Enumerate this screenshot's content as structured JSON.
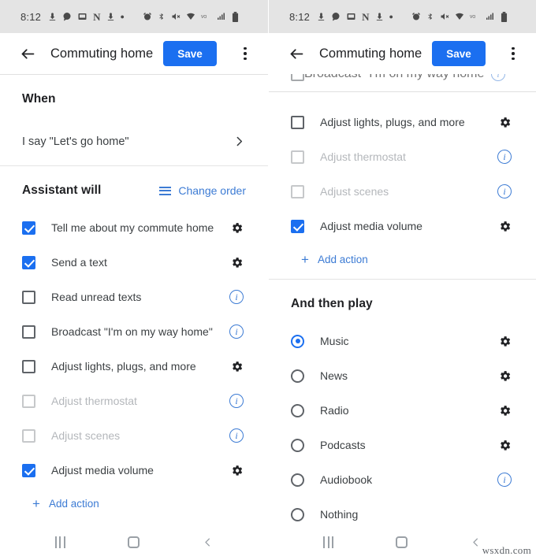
{
  "status_bar": {
    "time": "8:12",
    "icons": [
      "download-icon",
      "chat-bubble-icon",
      "screenshot-icon",
      "netflix-n-icon",
      "download-icon",
      "dot-icon",
      "alarm-icon",
      "bluetooth-icon",
      "mute-icon",
      "wifi-icon",
      "vo-lte-icon",
      "signal-icon",
      "battery-icon"
    ]
  },
  "app_bar": {
    "back_label": "back-arrow",
    "title": "Commuting home",
    "save_label": "Save",
    "overflow_label": "more-options"
  },
  "left_panel": {
    "when": {
      "heading": "When",
      "trigger_text": "I say \"Let's go home\"",
      "chevron": "chevron-right-icon"
    },
    "assistant": {
      "heading": "Assistant will",
      "change_order_label": "Change order",
      "actions": [
        {
          "label": "Tell me about my commute home",
          "checked": true,
          "disabled": false,
          "trailing": "gear"
        },
        {
          "label": "Send a text",
          "checked": true,
          "disabled": false,
          "trailing": "gear"
        },
        {
          "label": "Read unread texts",
          "checked": false,
          "disabled": false,
          "trailing": "info"
        },
        {
          "label": "Broadcast \"I'm on my way home\"",
          "checked": false,
          "disabled": false,
          "trailing": "info"
        },
        {
          "label": "Adjust lights, plugs, and more",
          "checked": false,
          "disabled": false,
          "trailing": "gear"
        },
        {
          "label": "Adjust thermostat",
          "checked": false,
          "disabled": true,
          "trailing": "info"
        },
        {
          "label": "Adjust scenes",
          "checked": false,
          "disabled": true,
          "trailing": "info"
        },
        {
          "label": "Adjust media volume",
          "checked": true,
          "disabled": false,
          "trailing": "gear"
        }
      ],
      "add_action_label": "Add action"
    }
  },
  "right_panel": {
    "clipped_action": {
      "label": "Broadcast \"I'm on my way home\"",
      "checked": false,
      "trailing": "info"
    },
    "assistant": {
      "actions": [
        {
          "label": "Adjust lights, plugs, and more",
          "checked": false,
          "disabled": false,
          "trailing": "gear"
        },
        {
          "label": "Adjust thermostat",
          "checked": false,
          "disabled": true,
          "trailing": "info"
        },
        {
          "label": "Adjust scenes",
          "checked": false,
          "disabled": true,
          "trailing": "info"
        },
        {
          "label": "Adjust media volume",
          "checked": true,
          "disabled": false,
          "trailing": "gear"
        }
      ],
      "add_action_label": "Add action"
    },
    "play": {
      "heading": "And then play",
      "options": [
        {
          "label": "Music",
          "selected": true,
          "trailing": "gear"
        },
        {
          "label": "News",
          "selected": false,
          "trailing": "gear"
        },
        {
          "label": "Radio",
          "selected": false,
          "trailing": "gear"
        },
        {
          "label": "Podcasts",
          "selected": false,
          "trailing": "gear"
        },
        {
          "label": "Audiobook",
          "selected": false,
          "trailing": "info"
        },
        {
          "label": "Nothing",
          "selected": false,
          "trailing": "none"
        }
      ]
    }
  },
  "nav_bar": {
    "recents_label": "recent-apps",
    "home_label": "home",
    "back_label": "back"
  },
  "watermark": "wsxdn.com",
  "colors": {
    "accent_blue": "#1b6ff0",
    "link_blue": "#3c7bd4",
    "text_primary": "#202124",
    "text_secondary": "#3c4043",
    "text_disabled": "#b4b7bb",
    "status_bar_bg": "#e4e4e4"
  }
}
